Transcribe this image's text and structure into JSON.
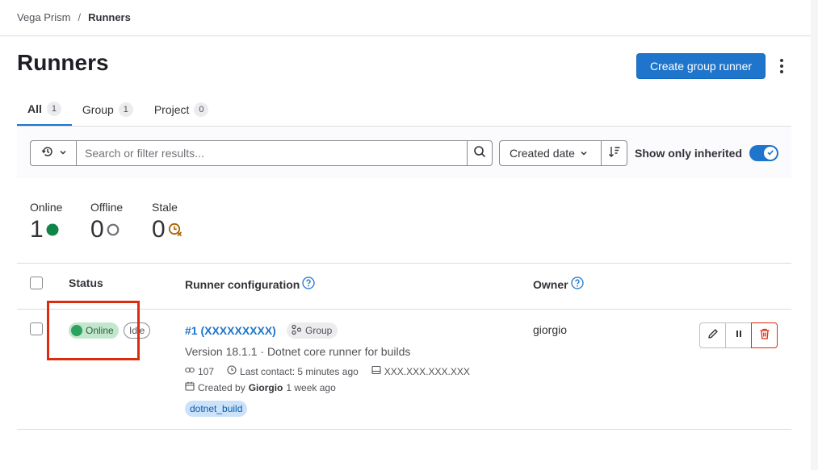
{
  "breadcrumb": {
    "parent": "Vega Prism",
    "separator": "/",
    "current": "Runners"
  },
  "page": {
    "title": "Runners",
    "create_button": "Create group runner"
  },
  "tabs": [
    {
      "label": "All",
      "count": "1",
      "active": true
    },
    {
      "label": "Group",
      "count": "1",
      "active": false
    },
    {
      "label": "Project",
      "count": "0",
      "active": false
    }
  ],
  "filter": {
    "search_placeholder": "Search or filter results...",
    "search_value": "",
    "sort_label": "Created date",
    "inherited_label": "Show only inherited",
    "inherited_enabled": true
  },
  "stats": [
    {
      "label": "Online",
      "value": "1",
      "icon": "online-dot-icon",
      "color": "#108548"
    },
    {
      "label": "Offline",
      "value": "0",
      "icon": "offline-circle-icon",
      "color": "#737278"
    },
    {
      "label": "Stale",
      "value": "0",
      "icon": "stale-clock-icon",
      "color": "#ab6100"
    }
  ],
  "table": {
    "headers": {
      "status": "Status",
      "config": "Runner configuration",
      "owner": "Owner"
    },
    "rows": [
      {
        "status": "Online",
        "state": "Idle",
        "name": "#1 (XXXXXXXXX)",
        "type": "Group",
        "description": "Version 18.1.1 · Dotnet core runner for builds",
        "job_count": "107",
        "last_contact": "Last contact: 5 minutes ago",
        "ip": "XXX.XXX.XXX.XXX",
        "created_prefix": "Created by",
        "created_by": "Giorgio",
        "created_when": "1 week ago",
        "tag": "dotnet_build",
        "owner": "giorgio"
      }
    ]
  },
  "colors": {
    "primary": "#1f75cb",
    "online": "#2da160",
    "danger": "#dd2b0e"
  }
}
